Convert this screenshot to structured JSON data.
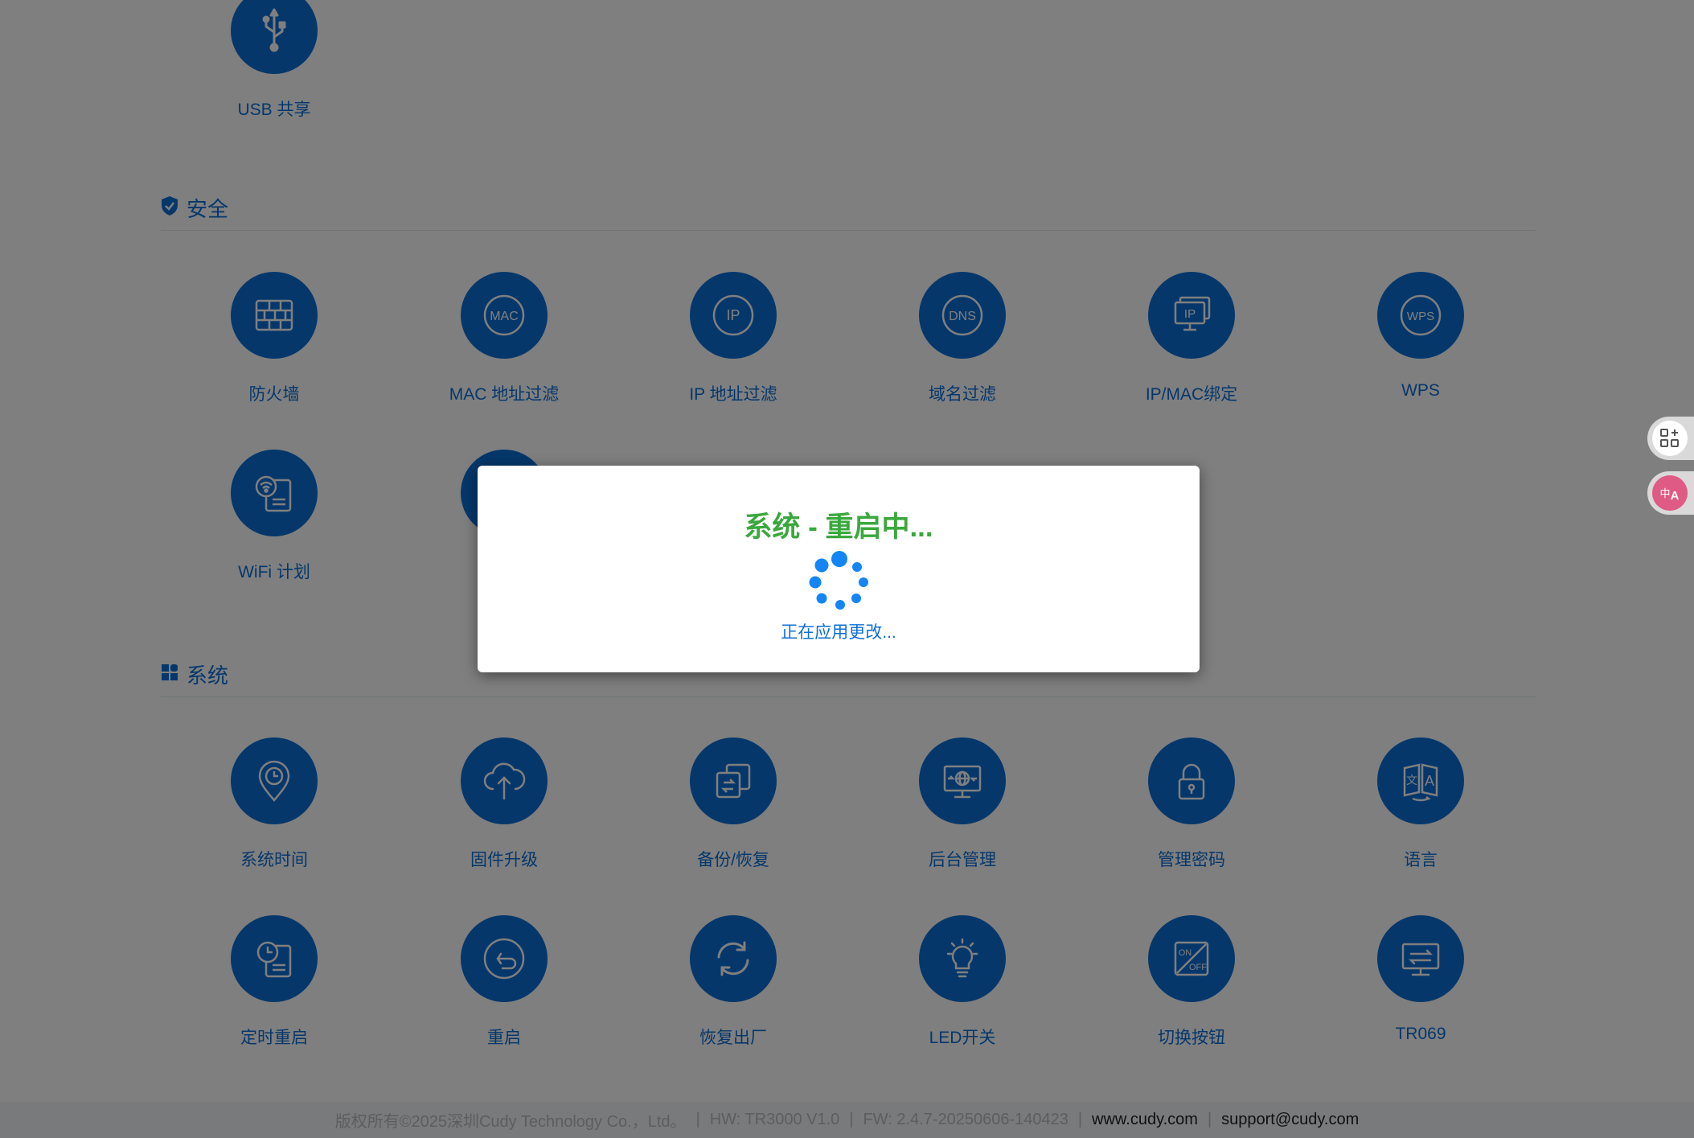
{
  "top_tiles": [
    {
      "label": "USB 共享",
      "icon": "usb-icon"
    }
  ],
  "security": {
    "title": "安全",
    "items": [
      {
        "label": "防火墙",
        "icon": "firewall-icon"
      },
      {
        "label": "MAC 地址过滤",
        "icon": "mac-filter-icon",
        "badge": "MAC"
      },
      {
        "label": "IP 地址过滤",
        "icon": "ip-filter-icon",
        "badge": "IP"
      },
      {
        "label": "域名过滤",
        "icon": "dns-filter-icon",
        "badge": "DNS"
      },
      {
        "label": "IP/MAC绑定",
        "icon": "ip-mac-binding-icon",
        "badge": "IP"
      },
      {
        "label": "WPS",
        "icon": "wps-icon",
        "badge": "WPS"
      },
      {
        "label": "WiFi 计划",
        "icon": "wifi-schedule-icon"
      }
    ]
  },
  "system": {
    "title": "系统",
    "items": [
      {
        "label": "系统时间",
        "icon": "system-time-icon"
      },
      {
        "label": "固件升级",
        "icon": "firmware-upgrade-icon"
      },
      {
        "label": "备份/恢复",
        "icon": "backup-restore-icon"
      },
      {
        "label": "后台管理",
        "icon": "remote-management-icon"
      },
      {
        "label": "管理密码",
        "icon": "admin-password-icon"
      },
      {
        "label": "语言",
        "icon": "language-icon"
      },
      {
        "label": "定时重启",
        "icon": "scheduled-reboot-icon"
      },
      {
        "label": "重启",
        "icon": "reboot-icon"
      },
      {
        "label": "恢复出厂",
        "icon": "factory-reset-icon"
      },
      {
        "label": "LED开关",
        "icon": "led-switch-icon"
      },
      {
        "label": "切换按钮",
        "icon": "switch-button-icon"
      },
      {
        "label": "TR069",
        "icon": "tr069-icon"
      }
    ]
  },
  "footer": {
    "copyright": "版权所有©2025深圳Cudy Technology Co.，Ltd。",
    "hw": "HW: TR3000 V1.0",
    "fw": "FW: 2.4.7-20250606-140423",
    "website": "www.cudy.com",
    "email": "support@cudy.com",
    "separator": "|"
  },
  "modal": {
    "title": "系统 - 重启中...",
    "subtitle": "正在应用更改..."
  },
  "side_buttons": [
    {
      "icon": "apps-add-icon"
    },
    {
      "icon": "translate-icon"
    }
  ],
  "colors": {
    "primary": "#0b6fd7",
    "success": "#3aa83d",
    "spinner": "#1485f5",
    "overlay": "rgba(0,0,0,0.5)",
    "translate_accent": "#e05a86"
  }
}
